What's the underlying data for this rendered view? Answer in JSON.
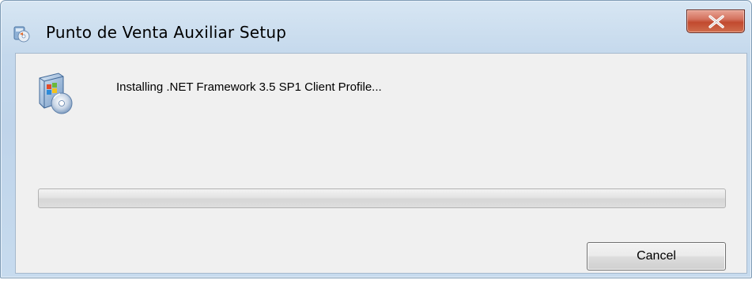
{
  "window": {
    "title": "Punto de Venta Auxiliar Setup",
    "close_icon": "close-x-icon",
    "app_icon": "setup-installer-icon"
  },
  "main": {
    "setup_icon": "installer-disc-icon",
    "status_text": "Installing .NET Framework 3.5 SP1 Client Profile...",
    "progress_percent": 0
  },
  "buttons": {
    "cancel_label": "Cancel"
  },
  "colors": {
    "close_button": "#c24a2f",
    "client_background": "#f0f0f0",
    "frame": "#c4d8ec"
  }
}
